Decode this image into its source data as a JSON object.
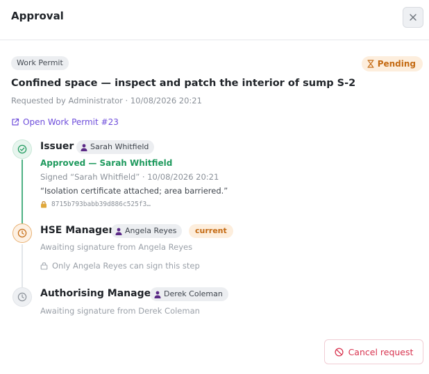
{
  "header": {
    "title": "Approval",
    "close_icon": "close-icon"
  },
  "request": {
    "type_badge": "Work Permit",
    "status": "Pending",
    "status_icon": "hourglass-icon",
    "title": "Confined space — inspect and patch the interior of sump S-2",
    "meta": "Requested by Administrator · 10/08/2026 20:21",
    "open_link": "Open Work Permit #23",
    "open_link_icon": "external-link-icon"
  },
  "steps": [
    {
      "role": "Issuer",
      "person": "Sarah Whitfield",
      "state": "approved",
      "icon": "check-circle-icon",
      "approved_text": "Approved — Sarah Whitfield",
      "signed_text": "Signed “Sarah Whitfield” · 10/08/2026 20:21",
      "comment": "“Isolation certificate attached; area barriered.”",
      "hash": "8715b793babb39d886c525f3…"
    },
    {
      "role": "HSE Manager",
      "person": "Angela Reyes",
      "state": "current",
      "icon": "clock-icon",
      "current_label": "current",
      "awaiting_text": "Awaiting signature from Angela Reyes",
      "only_text": "Only Angela Reyes can sign this step"
    },
    {
      "role": "Authorising Manager",
      "person": "Derek Coleman",
      "state": "pending",
      "icon": "clock-icon",
      "awaiting_text": "Awaiting signature from Derek Coleman"
    }
  ],
  "footer": {
    "cancel_label": "Cancel request",
    "cancel_icon": "ban-icon"
  },
  "colors": {
    "accent_link": "#6d4cdb",
    "approved": "#1f9a5e",
    "pending_orange": "#c46a12",
    "danger": "#d8334f",
    "person_icon": "#5b2a86"
  }
}
